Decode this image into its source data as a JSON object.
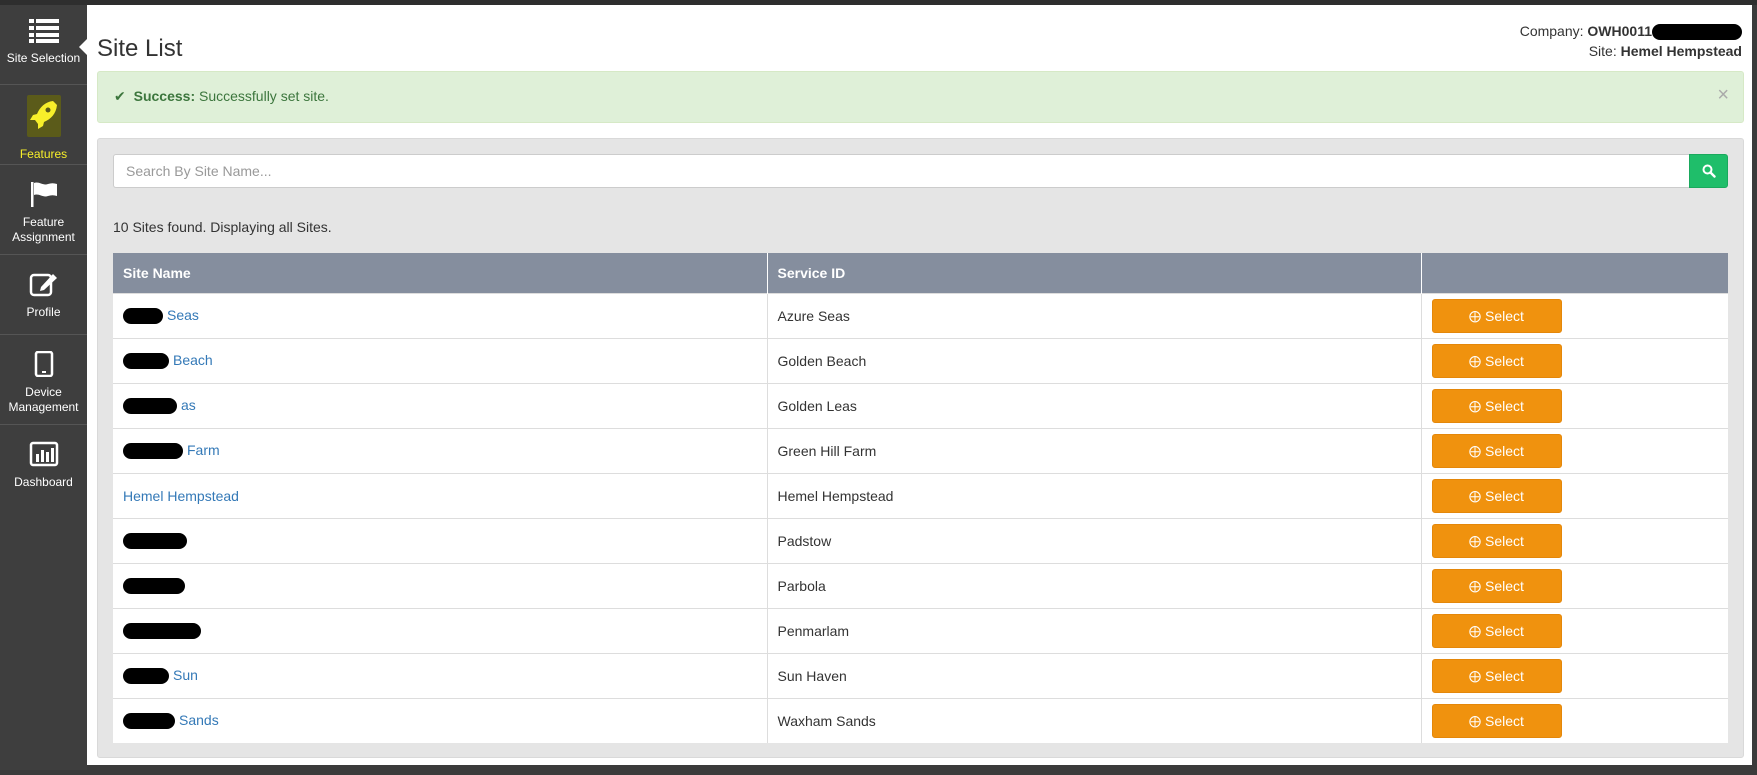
{
  "sidebar": {
    "items": [
      {
        "label": "Site Selection",
        "icon": "list-icon"
      },
      {
        "label": "Features",
        "icon": "rocket-icon"
      },
      {
        "label": "Feature Assignment",
        "icon": "flag-icon"
      },
      {
        "label": "Profile",
        "icon": "edit-icon"
      },
      {
        "label": "Device Management",
        "icon": "tablet-icon"
      },
      {
        "label": "Dashboard",
        "icon": "bar-chart-icon"
      }
    ]
  },
  "header": {
    "title": "Site List",
    "company_label": "Company:",
    "company_value": "OWH0011",
    "site_label": "Site:",
    "site_value": "Hemel Hempstead"
  },
  "alert": {
    "title": "Success:",
    "message": "Successfully set site.",
    "close": "×"
  },
  "search": {
    "placeholder": "Search By Site Name..."
  },
  "results": {
    "count_text": "10 Sites found. Displaying all Sites."
  },
  "table": {
    "headers": [
      "Site Name",
      "Service ID",
      ""
    ],
    "select_label": "Select",
    "rows": [
      {
        "site": "Seas",
        "service": "Azure Seas"
      },
      {
        "site": "Beach",
        "service": "Golden Beach"
      },
      {
        "site": "as",
        "service": "Golden Leas"
      },
      {
        "site": "Farm",
        "service": "Green Hill Farm"
      },
      {
        "site": "Hemel Hempstead",
        "service": "Hemel Hempstead"
      },
      {
        "site": "",
        "service": "Padstow"
      },
      {
        "site": "",
        "service": "Parbola"
      },
      {
        "site": "",
        "service": "Penmarlam"
      },
      {
        "site": "Sun",
        "service": "Sun Haven"
      },
      {
        "site": "Sands",
        "service": "Waxham Sands"
      }
    ]
  },
  "colors": {
    "sidebar_bg": "#3e3e3e",
    "active_label": "#f7ef2a",
    "table_header": "#858e9e",
    "select_button": "#f0920e",
    "search_button": "#1fbe6a",
    "alert_bg": "#dff0d8",
    "link": "#3479b7"
  }
}
